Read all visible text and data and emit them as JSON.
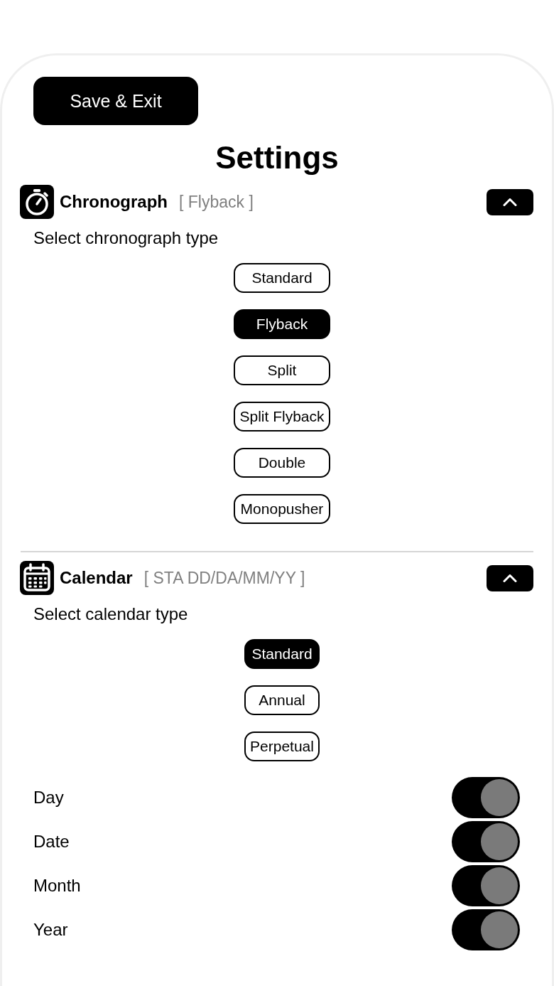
{
  "save_button": {
    "label": "Save & Exit"
  },
  "title": "Settings",
  "sections": [
    {
      "kind": "chronograph",
      "title": "Chronograph",
      "summary": "[ Flyback ]",
      "expanded": true,
      "prompt": "Select chronograph type",
      "options": [
        {
          "label": "Standard",
          "selected": false
        },
        {
          "label": "Flyback",
          "selected": true
        },
        {
          "label": "Split",
          "selected": false
        },
        {
          "label": "Split Flyback",
          "selected": false
        },
        {
          "label": "Double",
          "selected": false
        },
        {
          "label": "Monopusher",
          "selected": false
        }
      ]
    },
    {
      "kind": "calendar",
      "title": "Calendar",
      "summary": "[ STA DD/DA/MM/YY ]",
      "expanded": true,
      "prompt": "Select calendar type",
      "options": [
        {
          "label": "Standard",
          "selected": true
        },
        {
          "label": "Annual",
          "selected": false
        },
        {
          "label": "Perpetual",
          "selected": false
        }
      ],
      "toggles": [
        {
          "label": "Day",
          "on": true
        },
        {
          "label": "Date",
          "on": true
        },
        {
          "label": "Month",
          "on": true
        },
        {
          "label": "Year",
          "on": true
        }
      ]
    }
  ]
}
